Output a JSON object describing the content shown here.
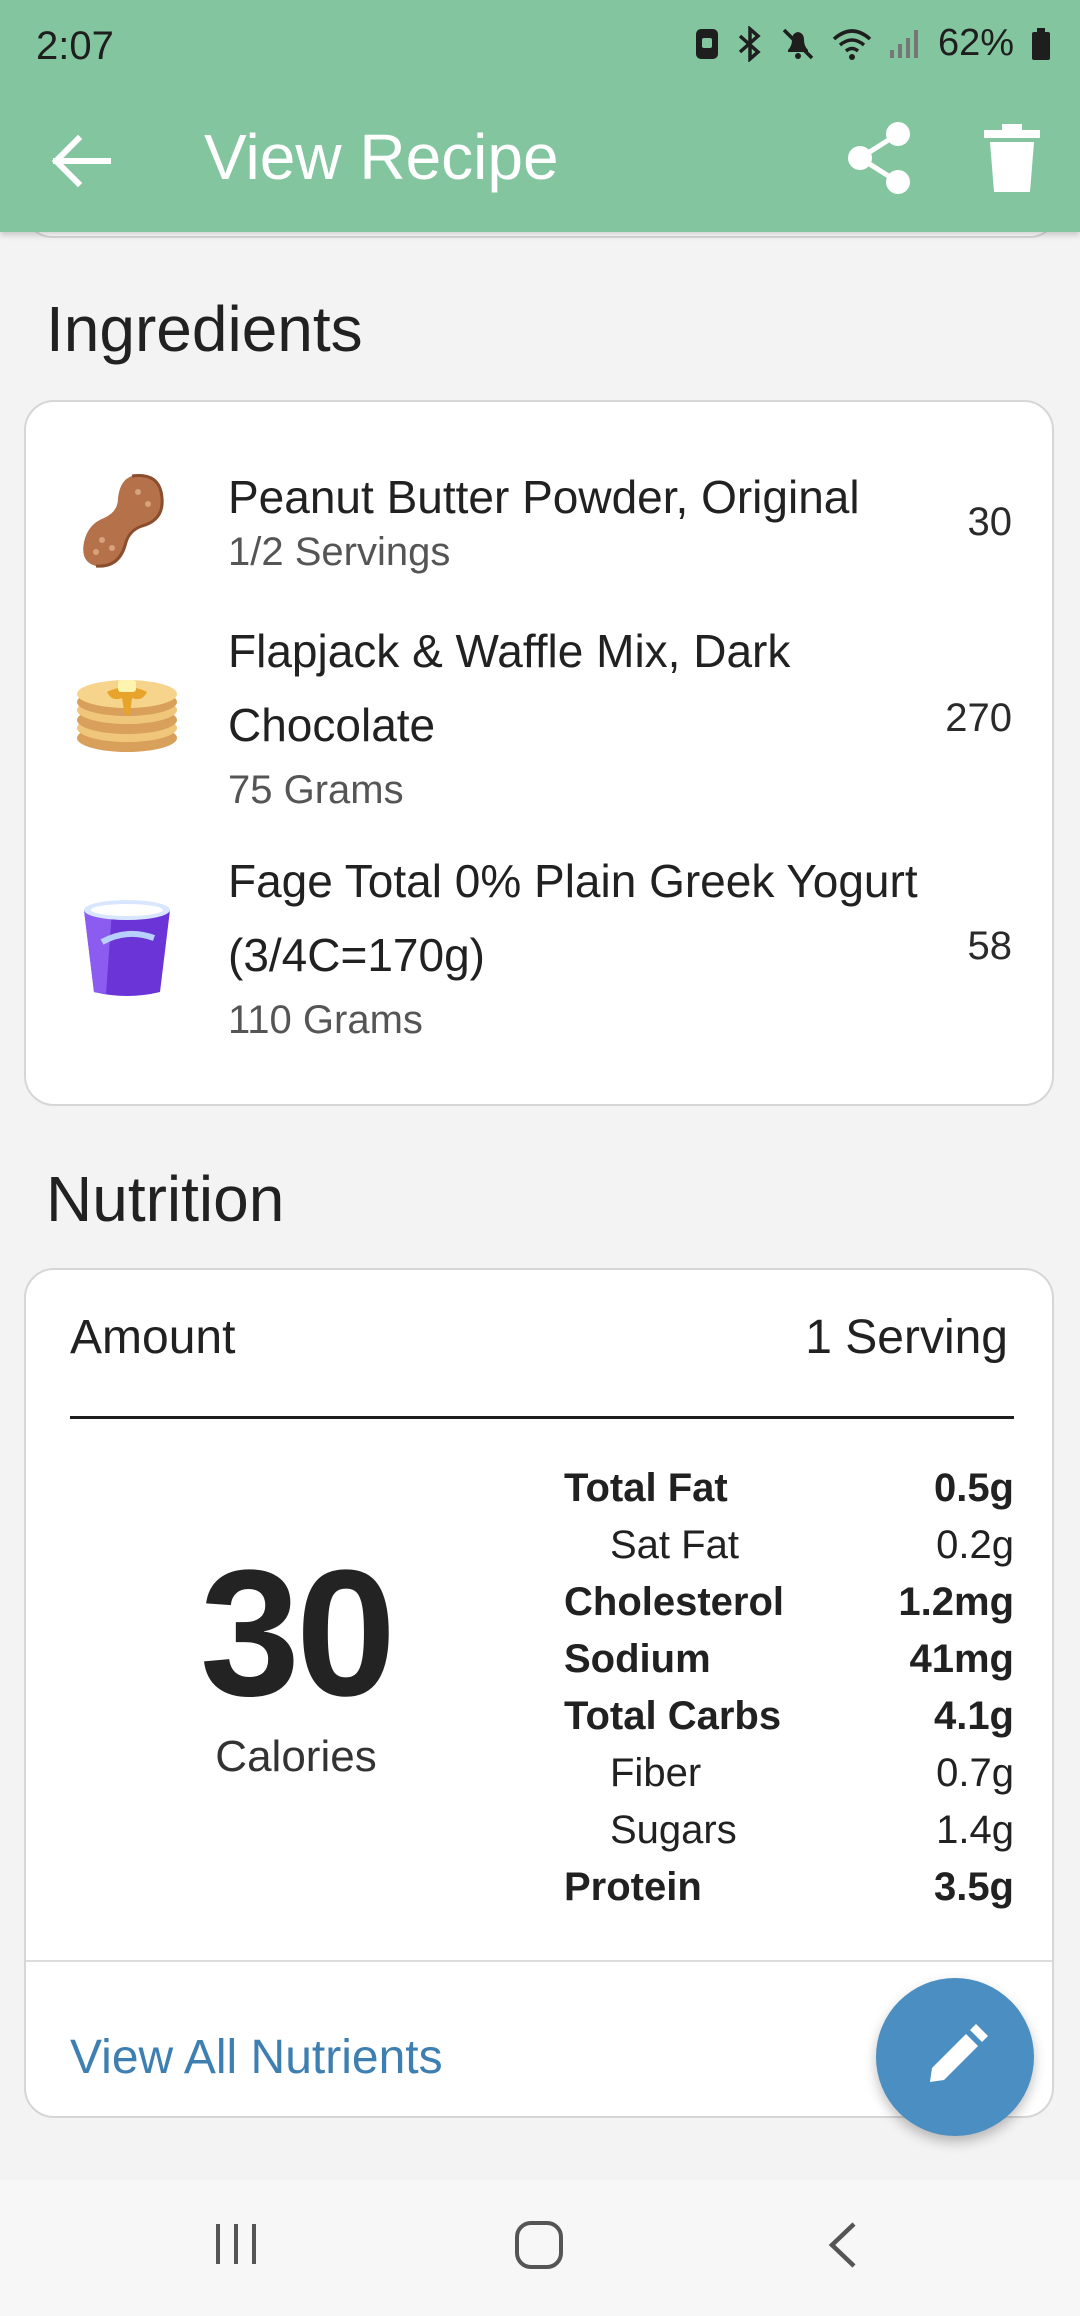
{
  "status_bar": {
    "time": "2:07",
    "battery": "62%",
    "icons": [
      "screenshot-icon",
      "bluetooth-icon",
      "mute-icon",
      "wifi-icon",
      "signal-icon",
      "battery-icon"
    ]
  },
  "toolbar": {
    "title": "View Recipe",
    "back_icon": "back-arrow-icon",
    "share_icon": "share-icon",
    "delete_icon": "trash-icon",
    "background": "#83c59f"
  },
  "ingredients": {
    "heading": "Ingredients",
    "items": [
      {
        "name": "Peanut Butter Powder, Original",
        "amount": "1/2 Servings",
        "calories": "30",
        "icon": "peanut-icon"
      },
      {
        "name": "Flapjack & Waffle Mix, Dark Chocolate",
        "amount": "75 Grams",
        "calories": "270",
        "icon": "pancakes-icon"
      },
      {
        "name": "Fage Total 0% Plain Greek Yogurt (3/4C=170g)",
        "amount": "110 Grams",
        "calories": "58",
        "icon": "yogurt-cup-icon"
      }
    ]
  },
  "nutrition": {
    "heading": "Nutrition",
    "amount_label": "Amount",
    "serving": "1 Serving",
    "calories_value": "30",
    "calories_label": "Calories",
    "rows": [
      {
        "label": "Total Fat",
        "value": "0.5g",
        "style": "bold"
      },
      {
        "label": "Sat Fat",
        "value": "0.2g",
        "style": "sub"
      },
      {
        "label": "Cholesterol",
        "value": "1.2mg",
        "style": "bold"
      },
      {
        "label": "Sodium",
        "value": "41mg",
        "style": "bold"
      },
      {
        "label": "Total Carbs",
        "value": "4.1g",
        "style": "bold"
      },
      {
        "label": "Fiber",
        "value": "0.7g",
        "style": "sub"
      },
      {
        "label": "Sugars",
        "value": "1.4g",
        "style": "sub"
      },
      {
        "label": "Protein",
        "value": "3.5g",
        "style": "bold"
      }
    ],
    "view_all": "View All Nutrients"
  },
  "fab": {
    "icon": "pencil-icon",
    "color": "#4a8ec2"
  },
  "nav_bar": {
    "icons": [
      "recent-apps-icon",
      "home-icon",
      "back-nav-icon"
    ]
  }
}
